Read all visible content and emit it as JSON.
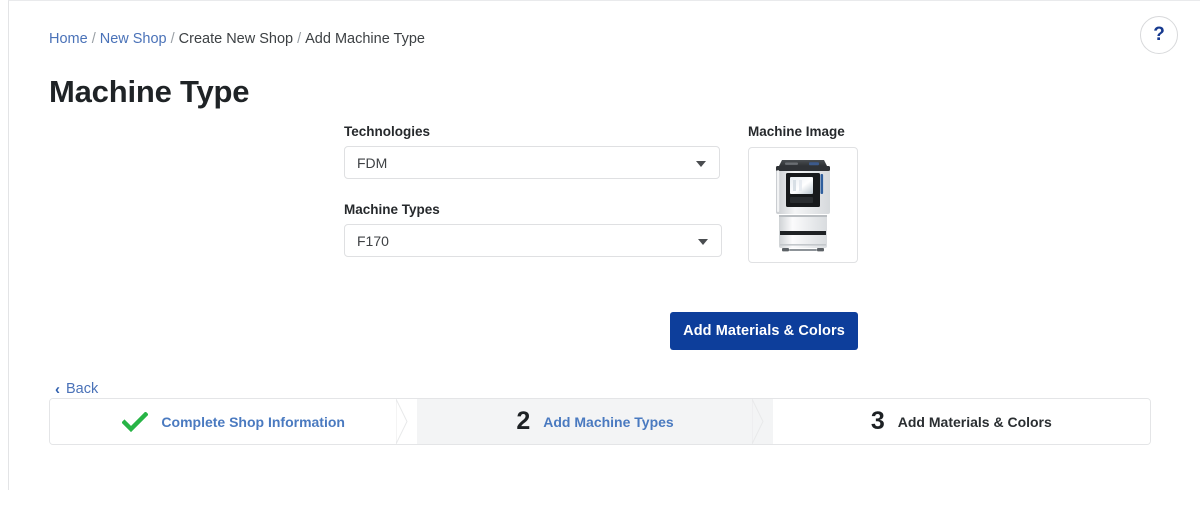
{
  "window": {
    "help_label": "?"
  },
  "breadcrumb": {
    "items": [
      {
        "label": "Home",
        "link": true
      },
      {
        "label": "New Shop",
        "link": true
      },
      {
        "label": "Create New Shop",
        "link": false
      },
      {
        "label": "Add Machine Type",
        "link": false
      }
    ],
    "separator": "/"
  },
  "page": {
    "title": "Machine Type"
  },
  "form": {
    "technologies": {
      "label": "Technologies",
      "value": "FDM"
    },
    "machine_types": {
      "label": "Machine Types",
      "value": "F170"
    }
  },
  "machine_image": {
    "label": "Machine Image",
    "alt": "3d-printer-image"
  },
  "actions": {
    "primary_button": "Add Materials & Colors",
    "back_label": "Back",
    "back_chevron": "‹"
  },
  "stepper": {
    "steps": [
      {
        "indicator": "check",
        "number": "",
        "label": "Complete Shop Information",
        "state": "done"
      },
      {
        "indicator": "number",
        "number": "2",
        "label": "Add Machine Types",
        "state": "active"
      },
      {
        "indicator": "number",
        "number": "3",
        "label": "Add Materials & Colors",
        "state": "pending"
      }
    ]
  },
  "colors": {
    "link_blue": "#4a72b8",
    "primary_blue": "#0d3e9b",
    "check_green": "#28b446",
    "active_step_bg": "#f3f4f5",
    "border_gray": "#e4e5e7"
  }
}
